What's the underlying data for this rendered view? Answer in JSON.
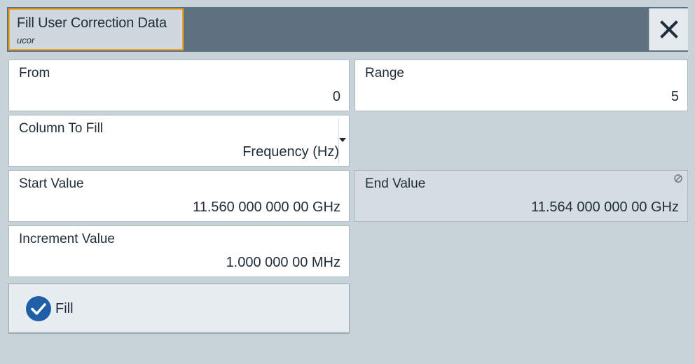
{
  "dialog": {
    "title": "Fill User Correction Data",
    "subtitle": "ucor"
  },
  "icons": {
    "close": "close-icon",
    "check": "check-circle-icon",
    "readonly": "readonly-icon",
    "dropdown": "dropdown-arrow-icon"
  },
  "colors": {
    "titlebar": "#5d7180",
    "accent": "#f0a428",
    "check": "#1f5fa8",
    "background": "#c8d2d9"
  },
  "fields": {
    "from": {
      "label": "From",
      "value": "0"
    },
    "range": {
      "label": "Range",
      "value": "5"
    },
    "column_to_fill": {
      "label": "Column To Fill",
      "value": "Frequency (Hz)"
    },
    "start_value": {
      "label": "Start Value",
      "value": "11.560 000 000 00 GHz"
    },
    "end_value": {
      "label": "End Value",
      "value": "11.564 000 000 00 GHz"
    },
    "increment_value": {
      "label": "Increment Value",
      "value": "1.000 000 00 MHz"
    }
  },
  "buttons": {
    "fill_label": "Fill"
  }
}
